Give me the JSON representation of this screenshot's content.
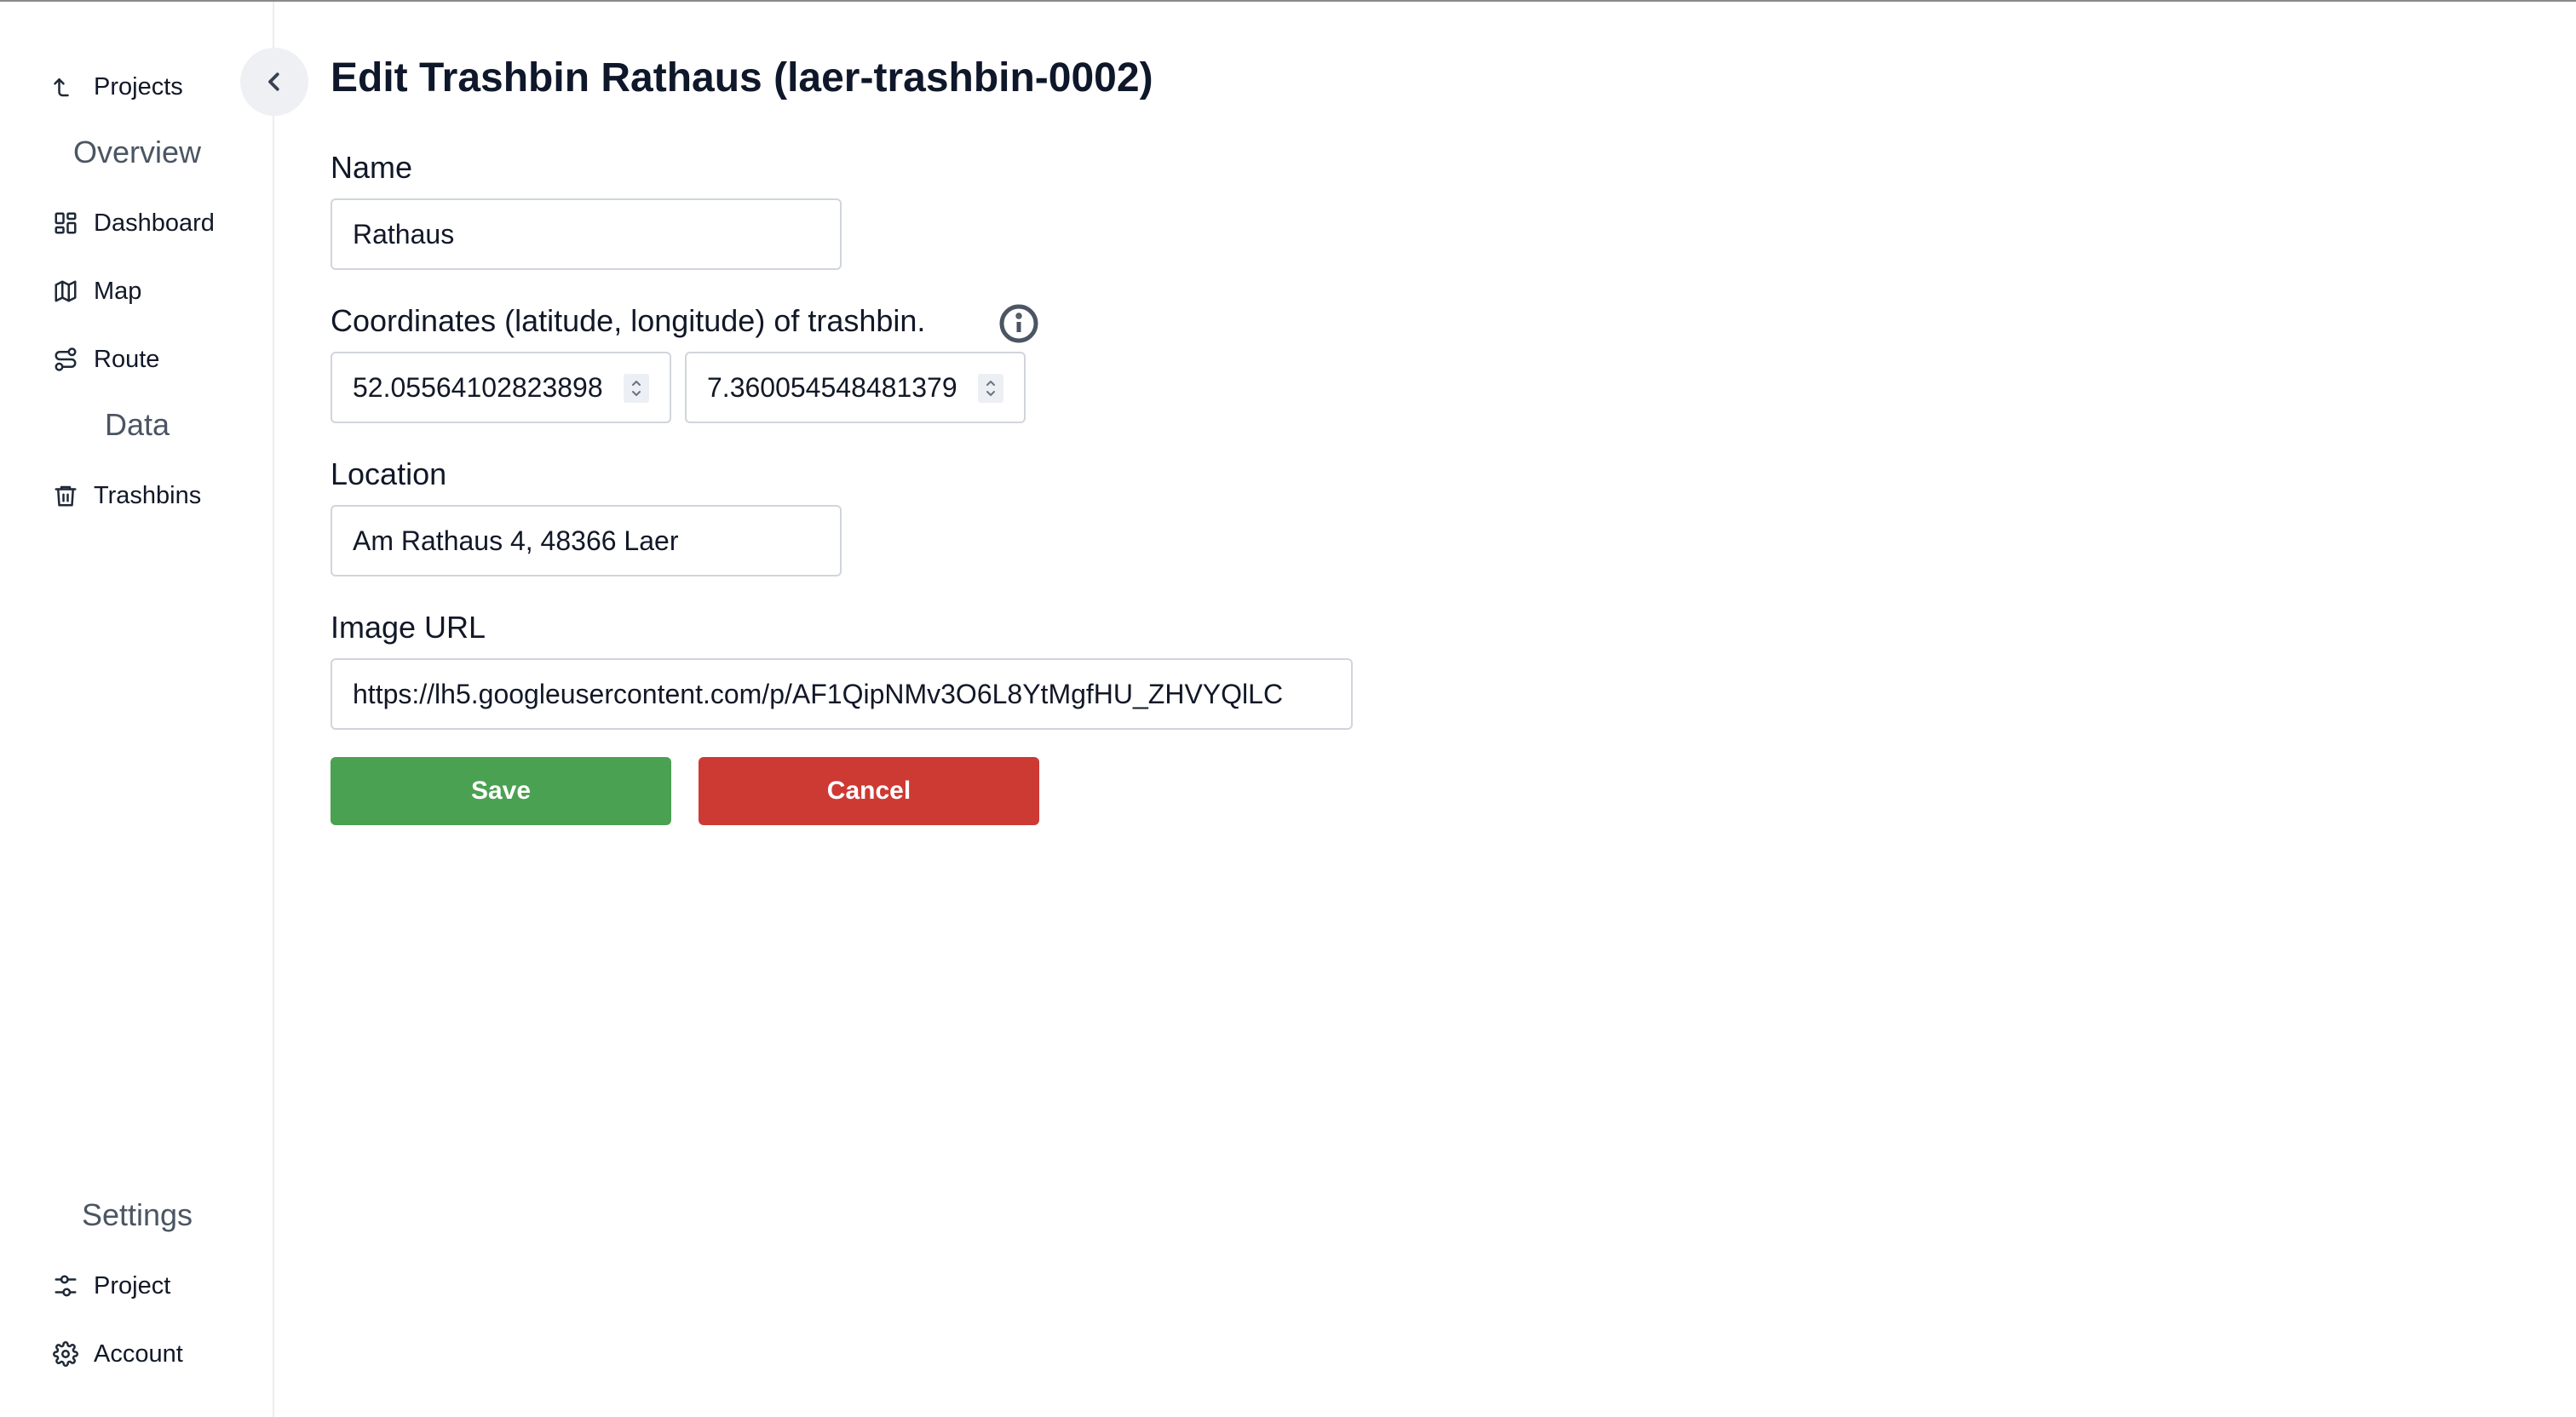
{
  "sidebar": {
    "back_label": "Projects",
    "overview_title": "Overview",
    "overview_items": [
      "Dashboard",
      "Map",
      "Route"
    ],
    "data_title": "Data",
    "data_items": [
      "Trashbins"
    ],
    "settings_title": "Settings",
    "settings_items": [
      "Project",
      "Account"
    ]
  },
  "page": {
    "title": "Edit Trashbin Rathaus (laer-trashbin-0002)"
  },
  "form": {
    "name_label": "Name",
    "name_value": "Rathaus",
    "coords_label": "Coordinates (latitude, longitude) of trashbin.",
    "latitude_value": "52.05564102823898",
    "longitude_value": "7.360054548481379",
    "location_label": "Location",
    "location_value": "Am Rathaus 4, 48366 Laer",
    "image_label": "Image URL",
    "image_value": "https://lh5.googleusercontent.com/p/AF1QipNMv3O6L8YtMgfHU_ZHVYQlLC",
    "save_label": "Save",
    "cancel_label": "Cancel"
  },
  "colors": {
    "save": "#4aa152",
    "cancel": "#cd3a34",
    "section_title": "#4b5563"
  },
  "icons": {
    "back": "corner-left-up-icon",
    "dashboard": "layout-grid-icon",
    "map": "map-icon",
    "route": "route-icon",
    "trashbins": "trash-icon",
    "project": "sliders-icon",
    "account": "gear-icon",
    "collapse": "chevron-left-icon",
    "info": "info-icon"
  }
}
